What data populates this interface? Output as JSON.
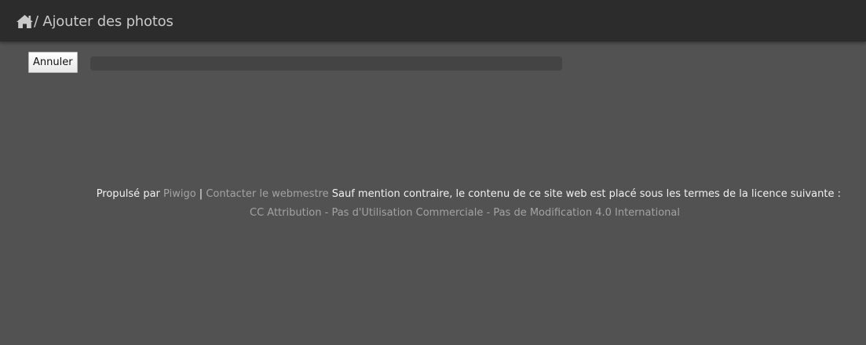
{
  "header": {
    "home_icon": "home-icon",
    "breadcrumb_text": "/ Ajouter des photos"
  },
  "toolbar": {
    "cancel_label": "Annuler"
  },
  "upload_progress": {
    "fraction": 0
  },
  "footer": {
    "powered_by": "Propulsé par",
    "piwigo_link": "Piwigo",
    "separator": "|",
    "contact_link": "Contacter le webmestre",
    "license_notice": "Sauf mention contraire, le contenu de ce site web est placé sous les termes de la licence suivante :",
    "license_link": "CC Attribution - Pas d'Utilisation Commerciale - Pas de Modification 4.0 International"
  },
  "colors": {
    "header_bg": "#2c2c2c",
    "page_bg": "#525252",
    "link": "#a3a3a3",
    "text": "#f2f2f2"
  }
}
